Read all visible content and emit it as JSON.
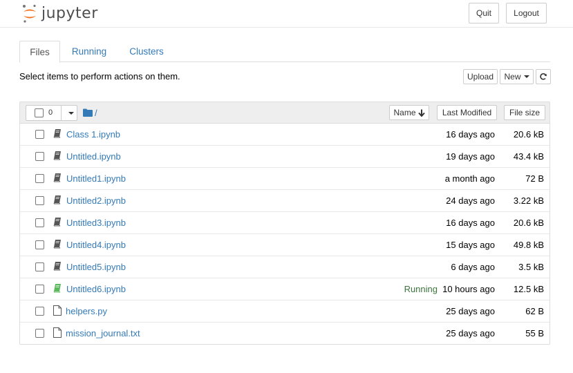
{
  "header": {
    "logo_text": "jupyter",
    "quit_label": "Quit",
    "logout_label": "Logout"
  },
  "tabs": [
    {
      "label": "Files",
      "active": true
    },
    {
      "label": "Running",
      "active": false
    },
    {
      "label": "Clusters",
      "active": false
    }
  ],
  "toolbar": {
    "hint": "Select items to perform actions on them.",
    "upload_label": "Upload",
    "new_label": "New"
  },
  "list_header": {
    "selected_count": "0",
    "path": "/",
    "sort_name_label": "Name",
    "last_modified_label": "Last Modified",
    "file_size_label": "File size"
  },
  "files": [
    {
      "name": "Class 1.ipynb",
      "type": "notebook",
      "status": "",
      "modified": "16 days ago",
      "size": "20.6 kB"
    },
    {
      "name": "Untitled.ipynb",
      "type": "notebook",
      "status": "",
      "modified": "19 days ago",
      "size": "43.4 kB"
    },
    {
      "name": "Untitled1.ipynb",
      "type": "notebook",
      "status": "",
      "modified": "a month ago",
      "size": "72 B"
    },
    {
      "name": "Untitled2.ipynb",
      "type": "notebook",
      "status": "",
      "modified": "24 days ago",
      "size": "3.22 kB"
    },
    {
      "name": "Untitled3.ipynb",
      "type": "notebook",
      "status": "",
      "modified": "16 days ago",
      "size": "20.6 kB"
    },
    {
      "name": "Untitled4.ipynb",
      "type": "notebook",
      "status": "",
      "modified": "15 days ago",
      "size": "49.8 kB"
    },
    {
      "name": "Untitled5.ipynb",
      "type": "notebook",
      "status": "",
      "modified": "6 days ago",
      "size": "3.5 kB"
    },
    {
      "name": "Untitled6.ipynb",
      "type": "notebook-running",
      "status": "Running",
      "modified": "10 hours ago",
      "size": "12.5 kB"
    },
    {
      "name": "helpers.py",
      "type": "file",
      "status": "",
      "modified": "25 days ago",
      "size": "62 B"
    },
    {
      "name": "mission_journal.txt",
      "type": "file",
      "status": "",
      "modified": "25 days ago",
      "size": "55 B"
    }
  ],
  "colors": {
    "link": "#337ab7",
    "running": "#3c763d",
    "logo_orange": "#f37726",
    "logo_gray": "#767677"
  }
}
